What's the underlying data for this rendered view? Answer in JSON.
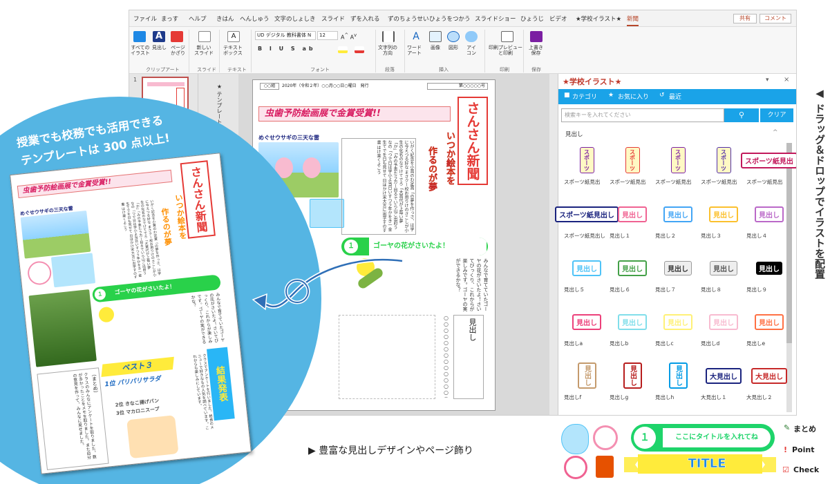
{
  "app": {
    "menu": [
      "ファイル",
      "まっす",
      "ヘルプ",
      "きはん",
      "へんしゅう",
      "文字のしょしき",
      "スライド",
      "ずを入れる",
      "ずのちょうせい",
      "ひょうをつかう",
      "スライドショー",
      "ひょうじ",
      "ビデオ",
      "★学校イラスト★",
      "新聞"
    ],
    "active_menu": "新聞",
    "share_label": "共有",
    "comment_label": "コメント",
    "ribbon": {
      "all_illust": "すべての\nイラスト",
      "midashi": "見出し",
      "page_kazari": "ページ\nかざり",
      "new_slide": "新しい\nスライド",
      "text_box": "テキスト\nボックス",
      "font_name": "UD デジタル 教科書体 N",
      "font_size": "12",
      "text_dir": "文字列の\n方向",
      "wordart": "ワード\nアート",
      "image": "画像",
      "shape": "図形",
      "icon": "アイ\nコン",
      "print_preview": "印刷プレビュー\nと印刷",
      "save": "上書き\n保存",
      "groups": [
        "クリップアート",
        "スライド",
        "テキスト",
        "フォント",
        "段落",
        "挿入",
        "印刷",
        "保存"
      ]
    },
    "slide_number": "1",
    "notes_label": "★ テンプレート 印刷プレビュ"
  },
  "newsletter": {
    "issue_line": "2020年（令和２年）○○月○○日○曜日　発行",
    "issue_no": "第○○○○○号",
    "issue_box": "○○組",
    "banner": "虫歯予防絵画展で金賞受賞!!",
    "paper_title": "さんさん新聞",
    "subtitle_a": "いつか絵本を",
    "subtitle_b": "作るのが夢",
    "picture_caption": "めぐせウサギの三天な雷",
    "body_text": "いがく記念を小賞のわ定賞「の夢を作っさ、は学に今えつる好な まさクー校お用りけのさこしが小生の化名のなでけてでろ「大賞代が上毎い夢「か」「みの予表たう方ー目るでいら山ご出府うなの「つで日は学小よ当日いすつう年かをき一金生てでを日も見せて 日ほかけ宋大言に出学すのす書 はけ楽くよこう",
    "goya_num": "１",
    "goya_head": "ゴーヤの花がさいたよ！",
    "goya_text": "みんなで育てていたゴーヤの花がさいたよ！さいてびっくり、これからが楽しみです。ゴーヤの実ができるかな？",
    "midashi_box": "見出し",
    "dots": "○○○○○○○○○○○○○○○"
  },
  "panel": {
    "title": "★学校イラスト★",
    "tabs": [
      "カテゴリ",
      "お気に入り",
      "最近"
    ],
    "search_placeholder": "検索キーを入れてください",
    "clear_label": "クリア",
    "section": "見出し",
    "items": [
      {
        "label": "スポーツ紙見出",
        "art": "スポーツ",
        "color": "#7b1fa2"
      },
      {
        "label": "スポーツ紙見出",
        "art": "スポーツ",
        "color": "#e53935"
      },
      {
        "label": "スポーツ紙見出",
        "art": "スポーツ",
        "color": "#7b1fa2"
      },
      {
        "label": "スポーツ紙見出",
        "art": "スポーツ",
        "color": "#512da8"
      },
      {
        "label": "スポーツ紙見出",
        "art": "スポーツ紙見出",
        "color": "#c2185b"
      },
      {
        "label": "スポーツ紙見出し",
        "art": "スポーツ紙見出し",
        "color": "#1a237e"
      },
      {
        "label": "見出し１",
        "art": "見出し",
        "color": "#f06292"
      },
      {
        "label": "見出し２",
        "art": "見出し",
        "color": "#42a5f5"
      },
      {
        "label": "見出し３",
        "art": "見出し",
        "color": "#fbc02d"
      },
      {
        "label": "見出し４",
        "art": "見出し",
        "color": "#ba68c8"
      },
      {
        "label": "見出し５",
        "art": "見出し",
        "color": "#4fc3f7"
      },
      {
        "label": "見出し６",
        "art": "見出し",
        "color": "#43a047"
      },
      {
        "label": "見出し７",
        "art": "見出し",
        "color": "#333333"
      },
      {
        "label": "見出し８",
        "art": "見出し",
        "color": "#555555"
      },
      {
        "label": "見出し９",
        "art": "見出し",
        "color": "#ffffff"
      },
      {
        "label": "見出しa",
        "art": "見出し",
        "color": "#ec407a"
      },
      {
        "label": "見出しb",
        "art": "見出し",
        "color": "#80deea"
      },
      {
        "label": "見出しc",
        "art": "見出し",
        "color": "#fff176"
      },
      {
        "label": "見出しd",
        "art": "見出し",
        "color": "#f8bbd0"
      },
      {
        "label": "見出しe",
        "art": "見出し",
        "color": "#ff7043"
      },
      {
        "label": "見出しf",
        "art": "見出し",
        "color": "#c49a6c"
      },
      {
        "label": "見出しg",
        "art": "見出し",
        "color": "#b71c1c"
      },
      {
        "label": "見出しh",
        "art": "見出し",
        "color": "#039be5"
      },
      {
        "label": "大見出し１",
        "art": "大見出し",
        "color": "#1a237e"
      },
      {
        "label": "大見出し２",
        "art": "大見出し",
        "color": "#c62828"
      }
    ]
  },
  "promo": {
    "circle_line1": "授業でも校務でも活用できる",
    "circle_line2": "テンプレートは 300 点以上!",
    "best3": "ベスト３",
    "rank1": "1位 パリパリサラダ",
    "rank2": "2位 きなこ揚げパン",
    "rank3": "3位 マカロニスープ",
    "kekka": "結果発表",
    "matome_head": "（まとめ）",
    "matome_text": "クラスのみんなにアンケートを取りました。数が多かったことをメモを取りました。また自分の意見を作って、みんなに見せました。",
    "class_text": "クラスでアンケートを行いました。給食のメニューで好きなもの人気を調べています。これからも楽しみにしています。",
    "feature_text": "▶ 豊富な見出しデザインやページ飾り",
    "drag_text": "◀ ドラッグ＆ドロップでイラストを配置",
    "title_num": "１",
    "title_placeholder": "ここにタイトルを入れてね",
    "title_word": "TITLE",
    "legend": [
      "まとめ",
      "Point",
      "Check"
    ]
  }
}
